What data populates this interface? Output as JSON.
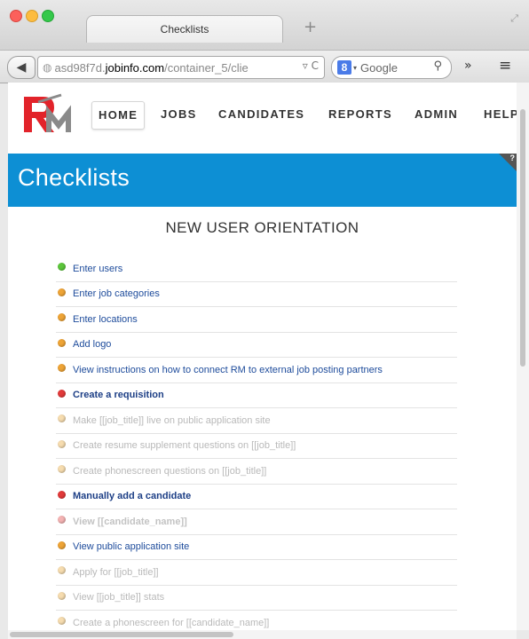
{
  "browser": {
    "tab_title": "Checklists",
    "url_prefix": "asd98f7d.",
    "url_domain": "jobinfo.com",
    "url_path": "/container_5/clie",
    "search_engine": "Google",
    "search_badge": "8"
  },
  "nav": {
    "items": [
      "HOME",
      "JOBS",
      "CANDIDATES",
      "REPORTS",
      "ADMIN",
      "HELP"
    ],
    "active": "HOME"
  },
  "banner": {
    "title": "Checklists",
    "help": "?",
    "color": "#0d8fd4"
  },
  "checklist": {
    "title": "NEW USER ORIENTATION",
    "items": [
      {
        "label": "Enter users",
        "status": "green",
        "bold": false,
        "muted": false
      },
      {
        "label": "Enter job categories",
        "status": "orange",
        "bold": false,
        "muted": false
      },
      {
        "label": "Enter locations",
        "status": "orange",
        "bold": false,
        "muted": false
      },
      {
        "label": "Add logo",
        "status": "orange",
        "bold": false,
        "muted": false
      },
      {
        "label": "View instructions on how to connect RM to external job posting partners",
        "status": "orange",
        "bold": false,
        "muted": false
      },
      {
        "label": "Create a requisition",
        "status": "red",
        "bold": true,
        "muted": false
      },
      {
        "label": "Make [[job_title]] live on public application site",
        "status": "orange-faded",
        "bold": false,
        "muted": true
      },
      {
        "label": "Create resume supplement questions on [[job_title]]",
        "status": "orange-faded",
        "bold": false,
        "muted": true
      },
      {
        "label": "Create phonescreen questions on [[job_title]]",
        "status": "orange-faded",
        "bold": false,
        "muted": true
      },
      {
        "label": "Manually add a candidate",
        "status": "red",
        "bold": true,
        "muted": false
      },
      {
        "label": "View [[candidate_name]]",
        "status": "red-faded",
        "bold": true,
        "muted": true
      },
      {
        "label": "View public application site",
        "status": "orange",
        "bold": false,
        "muted": false
      },
      {
        "label": "Apply for [[job_title]]",
        "status": "orange-faded",
        "bold": false,
        "muted": true
      },
      {
        "label": "View [[job_title]] stats",
        "status": "orange-faded",
        "bold": false,
        "muted": true
      },
      {
        "label": "Create a phonescreen for [[candidate_name]]",
        "status": "orange-faded",
        "bold": false,
        "muted": true
      }
    ]
  },
  "colors": {
    "green": "#5cc63b",
    "orange": "#eea436",
    "red": "#e23a3a",
    "orange-faded": "#f6dcaf",
    "red-faded": "#f4b3b3"
  }
}
